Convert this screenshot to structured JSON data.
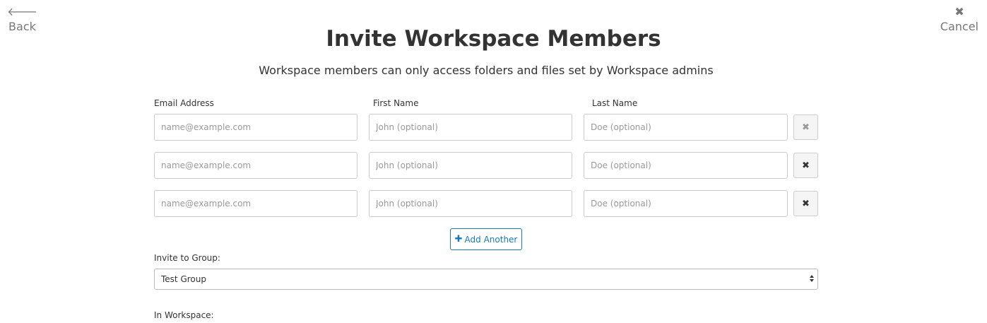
{
  "nav": {
    "back_label": "Back",
    "back_icon": "arrow-left-icon",
    "cancel_label": "Cancel",
    "cancel_icon": "close-icon"
  },
  "header": {
    "title": "Invite Workspace Members",
    "subtitle": "Workspace members can only access folders and files set by Workspace admins"
  },
  "form": {
    "columns": {
      "email": "Email Address",
      "first_name": "First Name",
      "last_name": "Last Name"
    },
    "placeholders": {
      "email": "name@example.com",
      "first_name": "John (optional)",
      "last_name": "Doe (optional)"
    },
    "rows": [
      {
        "email": "",
        "first_name": "",
        "last_name": "",
        "remove_enabled": false
      },
      {
        "email": "",
        "first_name": "",
        "last_name": "",
        "remove_enabled": true
      },
      {
        "email": "",
        "first_name": "",
        "last_name": "",
        "remove_enabled": true
      }
    ],
    "remove_glyph": "✖",
    "add_another": {
      "icon": "plus-icon",
      "glyph": "✚",
      "label": "Add Another"
    },
    "group": {
      "label": "Invite to Group:",
      "selected": "Test Group"
    },
    "workspace": {
      "label": "In Workspace:"
    }
  },
  "colors": {
    "accent": "#1a7ab5",
    "text": "#333333",
    "muted": "#777777",
    "border": "#cccccc"
  }
}
